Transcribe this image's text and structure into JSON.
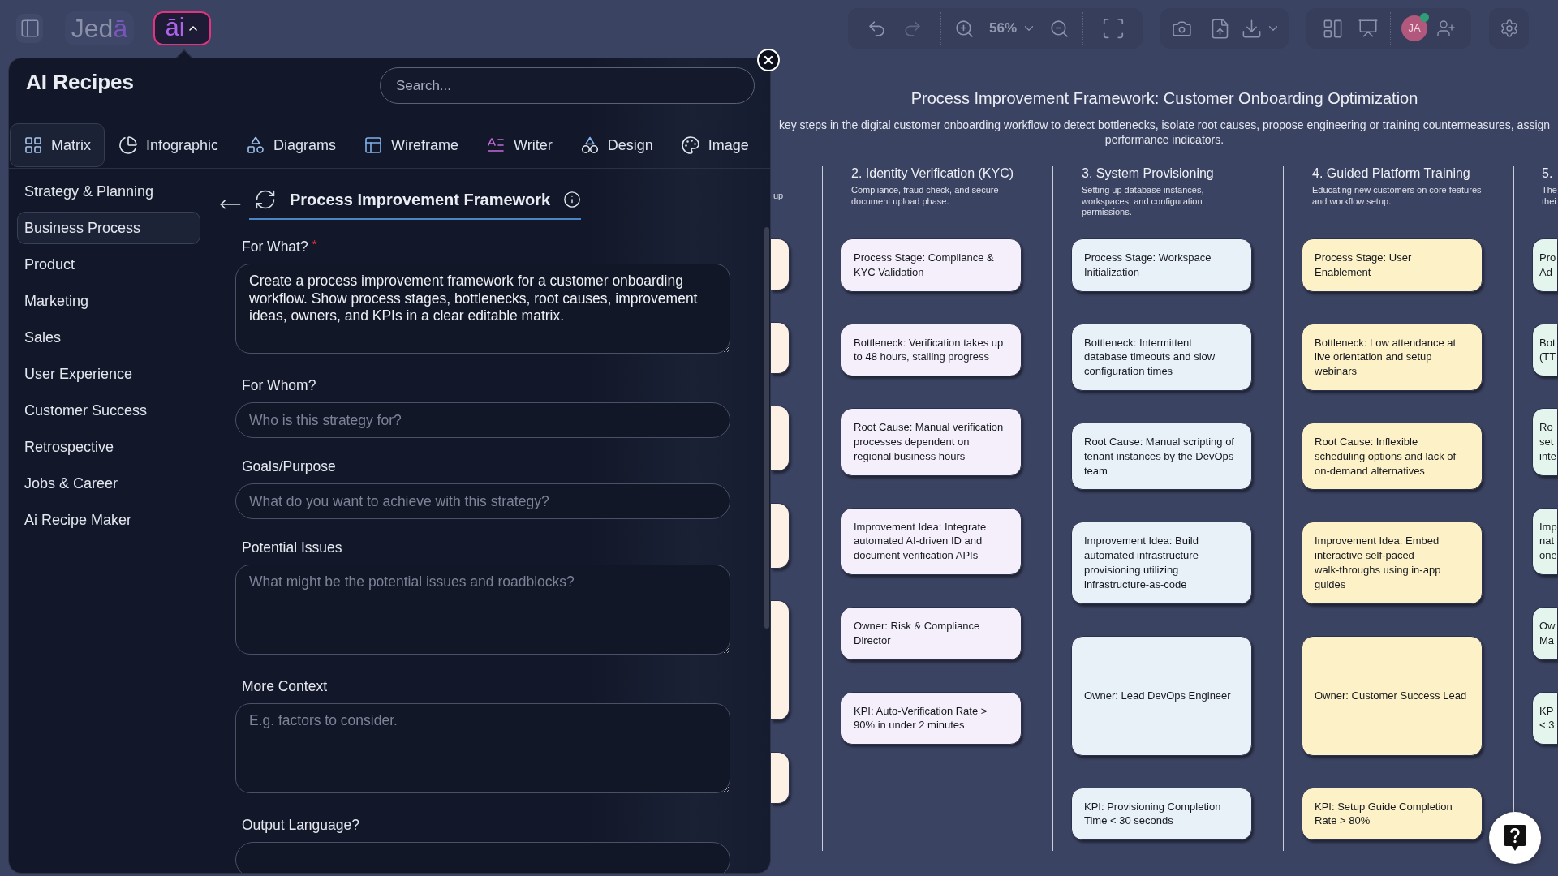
{
  "topbar": {
    "logo": {
      "text": "Jed",
      "accent": "ā"
    },
    "ai_button": {
      "text": "āi",
      "expanded": true
    },
    "zoom": "56%",
    "avatar": {
      "initials": "JA",
      "online": true
    }
  },
  "recipes_panel": {
    "title": "AI Recipes",
    "search": {
      "placeholder": "Search..."
    },
    "tabs": [
      {
        "label": "Matrix",
        "selected": true
      },
      {
        "label": "Infographic",
        "selected": false
      },
      {
        "label": "Diagrams",
        "selected": false
      },
      {
        "label": "Wireframe",
        "selected": false
      },
      {
        "label": "Writer",
        "selected": false
      },
      {
        "label": "Design",
        "selected": false
      },
      {
        "label": "Image",
        "selected": false
      }
    ],
    "categories": [
      {
        "label": "Strategy & Planning",
        "selected": false
      },
      {
        "label": "Business Process",
        "selected": true
      },
      {
        "label": "Product",
        "selected": false
      },
      {
        "label": "Marketing",
        "selected": false
      },
      {
        "label": "Sales",
        "selected": false
      },
      {
        "label": "User Experience",
        "selected": false
      },
      {
        "label": "Customer Success",
        "selected": false
      },
      {
        "label": "Retrospective",
        "selected": false
      },
      {
        "label": "Jobs & Career",
        "selected": false
      },
      {
        "label": "Ai Recipe Maker",
        "selected": false
      }
    ],
    "recipe": {
      "title": "Process Improvement Framework",
      "fields": [
        {
          "kind": "textarea",
          "label": "For What?",
          "required_mark": "*",
          "value": "Create a process improvement framework for a customer onboarding workflow. Show process stages, bottlenecks, root causes, improvement ideas, owners, and KPIs in a clear editable matrix."
        },
        {
          "kind": "input",
          "label": "For Whom?",
          "placeholder": "Who is this strategy for?"
        },
        {
          "kind": "input",
          "label": "Goals/Purpose",
          "placeholder": "What do you want to achieve with this strategy?"
        },
        {
          "kind": "textarea",
          "label": "Potential Issues",
          "placeholder": "What might be the potential issues and roadblocks?"
        },
        {
          "kind": "textarea",
          "label": "More Context",
          "placeholder": "E.g. factors to consider."
        },
        {
          "kind": "input",
          "label": "Output Language?"
        }
      ]
    }
  },
  "canvas": {
    "title": "Process Improvement Framework: Customer Onboarding Optimization",
    "subtitle": "key steps in the digital customer onboarding workflow to detect bottlenecks, isolate root causes, propose engineering or training countermeasures, assign\nperformance indicators.",
    "columns": [
      {
        "kind": "covered",
        "description": "up",
        "color": "#fdf0e4",
        "cards": [
          {
            "kind": "note"
          },
          {
            "kind": "note"
          },
          {
            "kind": "note"
          },
          {
            "kind": "note"
          },
          {
            "kind": "note"
          },
          {
            "kind": "note"
          }
        ]
      },
      {
        "kind": "full",
        "title": "2. Identity Verification (KYC)",
        "description": "Compliance, fraud check, and secure\ndocument upload phase.",
        "color": "#f4effa",
        "cards": [
          {
            "text": "Process Stage: Compliance &\nKYC Validation"
          },
          {
            "text": "Bottleneck: Verification takes up\nto 48 hours, stalling progress"
          },
          {
            "text": "Root Cause: Manual verification\nprocesses dependent on\nregional business hours"
          },
          {
            "text": "Improvement Idea: Integrate\nautomated AI-driven ID and\ndocument verification APIs"
          },
          {
            "text": "Owner: Risk & Compliance\nDirector"
          },
          {
            "text": "KPI: Auto-Verification Rate >\n90% in under 2 minutes"
          }
        ]
      },
      {
        "kind": "full",
        "title": "3. System Provisioning",
        "description": "Setting up database instances,\nworkspaces, and configuration\npermissions.",
        "color": "#e8f0f8",
        "cards": [
          {
            "text": "Process Stage: Workspace\nInitialization"
          },
          {
            "text": "Bottleneck: Intermittent\ndatabase timeouts and slow\nconfiguration times"
          },
          {
            "text": "Root Cause: Manual scripting of\ntenant instances by the DevOps\nteam"
          },
          {
            "text": "Improvement Idea: Build\nautomated infrastructure\nprovisioning utilizing\ninfrastructure-as-code"
          },
          {
            "text": "Owner: Lead DevOps Engineer"
          },
          {
            "text": "KPI: Provisioning Completion\nTime < 30 seconds"
          }
        ]
      },
      {
        "kind": "full",
        "title": "4. Guided Platform Training",
        "description": "Educating new customers on core features\nand workflow setup.",
        "color": "#fdf1c8",
        "cards": [
          {
            "text": "Process Stage: User\nEnablement"
          },
          {
            "text": "Bottleneck: Low attendance at\nlive orientation and setup\nwebinars"
          },
          {
            "text": "Root Cause: Inflexible\nscheduling options and lack of\non-demand alternatives"
          },
          {
            "text": "Improvement Idea: Embed\ninteractive self-paced\nwalk-throughs using in-app\nguides"
          },
          {
            "text": "Owner: Customer Success Lead"
          },
          {
            "text": "KPI: Setup Guide Completion\nRate > 80%"
          }
        ]
      },
      {
        "kind": "cut",
        "title": "5.",
        "lines": [
          "The",
          "thei"
        ],
        "color": "#e4f5ee",
        "cards": [
          {
            "lines": [
              "Pro",
              "Ad"
            ]
          },
          {
            "lines": [
              "Bot",
              "(TT"
            ]
          },
          {
            "lines": [
              "Ro",
              "set",
              "inte"
            ]
          },
          {
            "lines": [
              "Imp",
              "nat",
              "one"
            ]
          },
          {
            "lines": [
              "Ow",
              "Ma"
            ]
          },
          {
            "lines": [
              "KP",
              "< 3"
            ]
          }
        ]
      }
    ]
  }
}
